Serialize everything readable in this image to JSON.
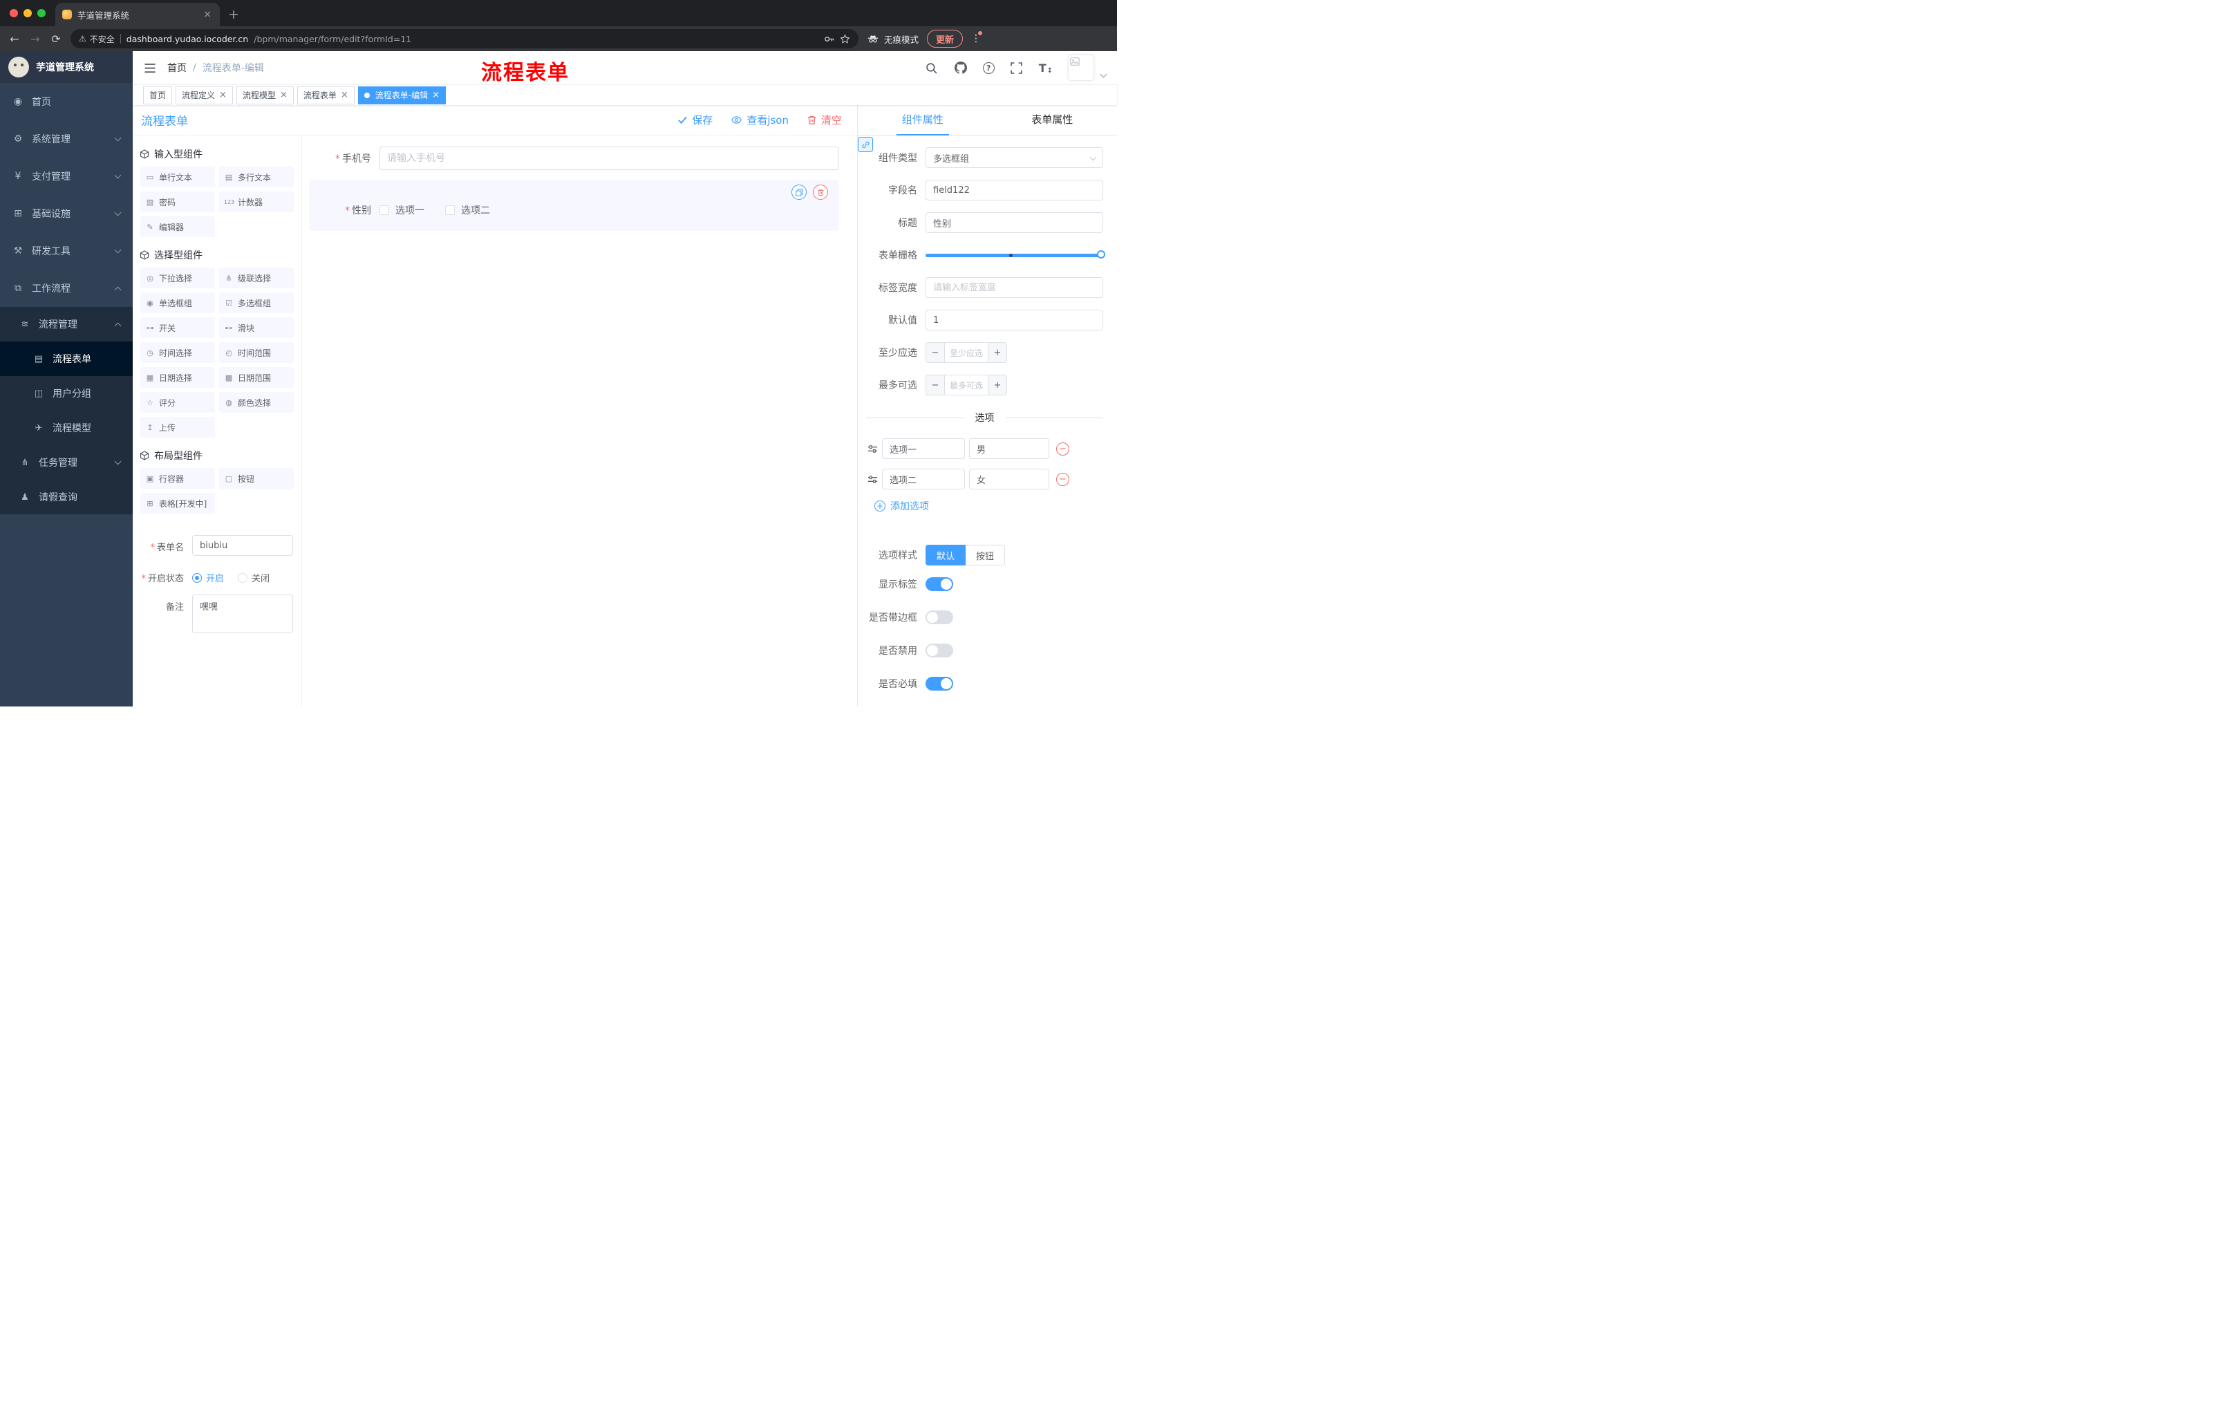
{
  "browser": {
    "tab_title": "芋道管理系统",
    "security": "不安全",
    "url_host": "dashboard.yudao.iocoder.cn",
    "url_path": "/bpm/manager/form/edit?formId=11",
    "incognito": "无痕模式",
    "update": "更新"
  },
  "sidebar": {
    "app_title": "芋道管理系统",
    "items": [
      {
        "label": "首页",
        "glyph": "◉"
      },
      {
        "label": "系统管理",
        "glyph": "⚙"
      },
      {
        "label": "支付管理",
        "glyph": "¥"
      },
      {
        "label": "基础设施",
        "glyph": "⊞"
      },
      {
        "label": "研发工具",
        "glyph": "⚒"
      },
      {
        "label": "工作流程",
        "glyph": "⧉"
      }
    ],
    "submenu": [
      {
        "label": "流程管理",
        "glyph": "≋"
      },
      {
        "label": "流程表单",
        "glyph": "▤"
      },
      {
        "label": "用户分组",
        "glyph": "◫"
      },
      {
        "label": "流程模型",
        "glyph": "✈"
      },
      {
        "label": "任务管理",
        "glyph": "⋔"
      },
      {
        "label": "请假查询",
        "glyph": "♟"
      }
    ]
  },
  "header": {
    "breadcrumb_home": "首页",
    "breadcrumb_sep": "/",
    "breadcrumb_current": "流程表单-编辑",
    "annotation": "流程表单"
  },
  "tags": [
    {
      "label": "首页"
    },
    {
      "label": "流程定义"
    },
    {
      "label": "流程模型"
    },
    {
      "label": "流程表单"
    },
    {
      "label": "流程表单-编辑"
    }
  ],
  "toolbar": {
    "title": "流程表单",
    "save": "保存",
    "view_json": "查看json",
    "clear": "清空"
  },
  "palette": {
    "groups": [
      {
        "title": "输入型组件",
        "items": [
          {
            "label": "单行文本",
            "glyph": "▭"
          },
          {
            "label": "多行文本",
            "glyph": "▤"
          },
          {
            "label": "密码",
            "glyph": "▧"
          },
          {
            "label": "计数器",
            "glyph": "123"
          },
          {
            "label": "编辑器",
            "glyph": "✎"
          }
        ]
      },
      {
        "title": "选择型组件",
        "items": [
          {
            "label": "下拉选择",
            "glyph": "◎"
          },
          {
            "label": "级联选择",
            "glyph": "⋔"
          },
          {
            "label": "单选框组",
            "glyph": "◉"
          },
          {
            "label": "多选框组",
            "glyph": "☑"
          },
          {
            "label": "开关",
            "glyph": "⊶"
          },
          {
            "label": "滑块",
            "glyph": "⊷"
          },
          {
            "label": "时间选择",
            "glyph": "◷"
          },
          {
            "label": "时间范围",
            "glyph": "◴"
          },
          {
            "label": "日期选择",
            "glyph": "▦"
          },
          {
            "label": "日期范围",
            "glyph": "▩"
          },
          {
            "label": "评分",
            "glyph": "☆"
          },
          {
            "label": "颜色选择",
            "glyph": "◍"
          },
          {
            "label": "上传",
            "glyph": "↥"
          }
        ]
      },
      {
        "title": "布局型组件",
        "items": [
          {
            "label": "行容器",
            "glyph": "▣"
          },
          {
            "label": "按钮",
            "glyph": "▢"
          },
          {
            "label": "表格[开发中]",
            "glyph": "⊞"
          }
        ]
      }
    ]
  },
  "form_meta": {
    "name_label": "表单名",
    "name_value": "biubiu",
    "status_label": "开启状态",
    "status_on": "开启",
    "status_off": "关闭",
    "remark_label": "备注",
    "remark_value": "嘿嘿"
  },
  "canvas": {
    "phone_label": "手机号",
    "phone_placeholder": "请输入手机号",
    "gender_label": "性别",
    "gender_options": [
      {
        "label": "选项一"
      },
      {
        "label": "选项二"
      }
    ]
  },
  "props": {
    "tab_component": "组件属性",
    "tab_form": "表单属性",
    "type_label": "组件类型",
    "type_value": "多选框组",
    "field_label": "字段名",
    "field_value": "field122",
    "title_label": "标题",
    "title_value": "性别",
    "grid_label": "表单栅格",
    "width_label": "标签宽度",
    "width_placeholder": "请输入标签宽度",
    "default_label": "默认值",
    "default_value": "1",
    "min_label": "至少应选",
    "min_placeholder": "至少应选",
    "max_label": "最多可选",
    "max_placeholder": "最多可选",
    "options_title": "选项",
    "options": [
      {
        "label": "选项一",
        "value": "男"
      },
      {
        "label": "选项二",
        "value": "女"
      }
    ],
    "add_option": "添加选项",
    "style_label": "选项样式",
    "style_default": "默认",
    "style_button": "按钮",
    "toggle_show_label": "显示标签",
    "toggle_border": "是否带边框",
    "toggle_disabled": "是否禁用",
    "toggle_required": "是否必填"
  }
}
